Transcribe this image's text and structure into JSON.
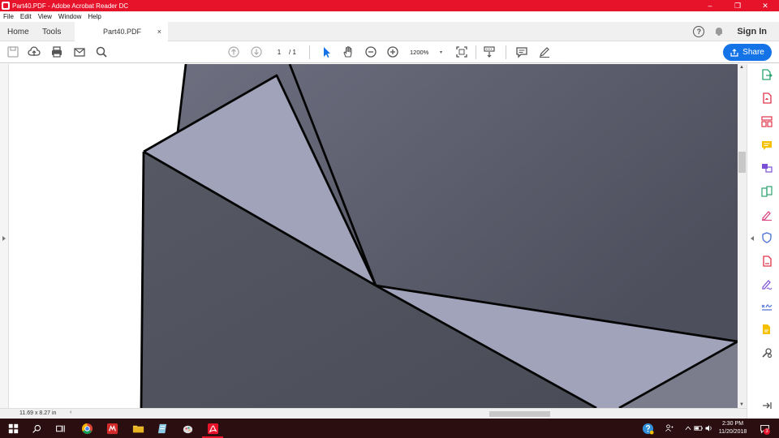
{
  "window": {
    "title": "Part40.PDF - Adobe Acrobat Reader DC",
    "minimize": "–",
    "maximize": "❐",
    "close": "✕"
  },
  "menu": {
    "items": [
      "File",
      "Edit",
      "View",
      "Window",
      "Help"
    ]
  },
  "tabs": {
    "home": "Home",
    "tools": "Tools",
    "document": "Part40.PDF",
    "close": "×",
    "help": "?",
    "signin": "Sign In"
  },
  "toolbar": {
    "page_current": "1",
    "page_total": "/  1",
    "zoom": "1200%",
    "zoom_caret": "▾",
    "share_label": "Share"
  },
  "status": {
    "page_size": "11.69 x 8.27 in",
    "scroll_left": "‹"
  },
  "scrollbar": {
    "up": "▲",
    "down": "▼"
  },
  "taskbar": {
    "time": "2:30 PM",
    "date": "11/20/2018",
    "notification_count": "3"
  },
  "colors": {
    "title_bar": "#e6132b",
    "accent": "#1473e6",
    "taskbar": "#2b0e10"
  },
  "icons": {
    "right_panel": [
      "export-pdf-icon",
      "create-pdf-icon",
      "organize-pages-icon",
      "comment-icon",
      "send-for-review-icon",
      "combine-files-icon",
      "fill-sign-icon",
      "protect-icon",
      "edit-pdf-icon",
      "sign-icon",
      "certificate-icon",
      "export-file-icon",
      "more-tools-icon",
      "collapse-panel-icon"
    ]
  }
}
